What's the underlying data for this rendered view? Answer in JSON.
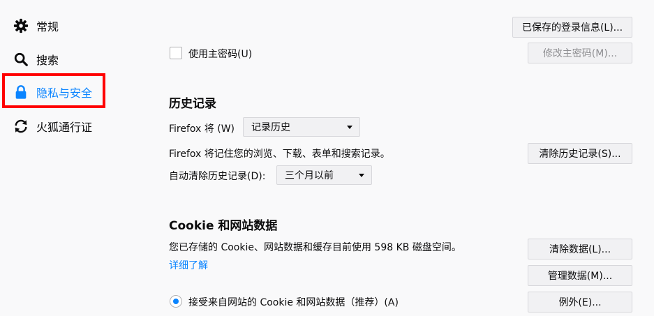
{
  "sidebar": {
    "items": [
      {
        "label": "常规",
        "icon": "gear-icon"
      },
      {
        "label": "搜索",
        "icon": "search-icon"
      },
      {
        "label": "隐私与安全",
        "icon": "lock-icon",
        "active": true
      },
      {
        "label": "火狐通行证",
        "icon": "sync-icon"
      }
    ]
  },
  "logins": {
    "saved_logins_button": "已保存的登录信息(L)...",
    "master_password_checkbox": "使用主密码(U)",
    "change_master_password_button": "修改主密码(M)..."
  },
  "history": {
    "heading": "历史记录",
    "firefox_will_label": "Firefox 将 (W)",
    "mode_value": "记录历史",
    "description": "Firefox 将记住您的浏览、下载、表单和搜索记录。",
    "clear_history_button": "清除历史记录(S)...",
    "auto_clear_label": "自动清除历史记录(D):",
    "auto_clear_value": "三个月以前"
  },
  "cookies": {
    "heading": "Cookie 和网站数据",
    "usage_text": "您已存储的 Cookie、网站数据和缓存目前使用 598 KB 磁盘空间。",
    "learn_more_link": "详细了解",
    "clear_data_button": "清除数据(L)...",
    "manage_data_button": "管理数据(M)...",
    "accept_radio_label": "接受来自网站的 Cookie 和网站数据（推荐）(A)",
    "exceptions_button": "例外(E)..."
  },
  "colors": {
    "accent": "#0a84ff",
    "highlight": "#ff0000",
    "background": "#f9f9fa"
  }
}
